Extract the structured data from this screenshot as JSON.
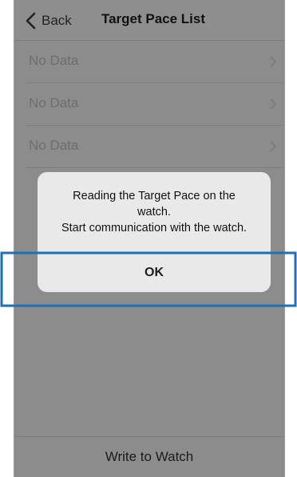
{
  "navbar": {
    "back_label": "Back",
    "title": "Target Pace List"
  },
  "list": {
    "items": [
      {
        "label": "No Data"
      },
      {
        "label": "No Data"
      },
      {
        "label": "No Data"
      }
    ]
  },
  "dialog": {
    "message_lines": [
      "Reading the Target Pace on the",
      "watch.",
      "Start communication with the watch."
    ],
    "ok_label": "OK"
  },
  "footer": {
    "write_label": "Write to Watch"
  },
  "colors": {
    "overlay_bg": "#8c8c8c",
    "dialog_bg": "#e9e9e9",
    "highlight_stroke": "#1f6fb5"
  },
  "icons": {
    "back": "chevron-left-icon",
    "row": "chevron-right-icon"
  }
}
